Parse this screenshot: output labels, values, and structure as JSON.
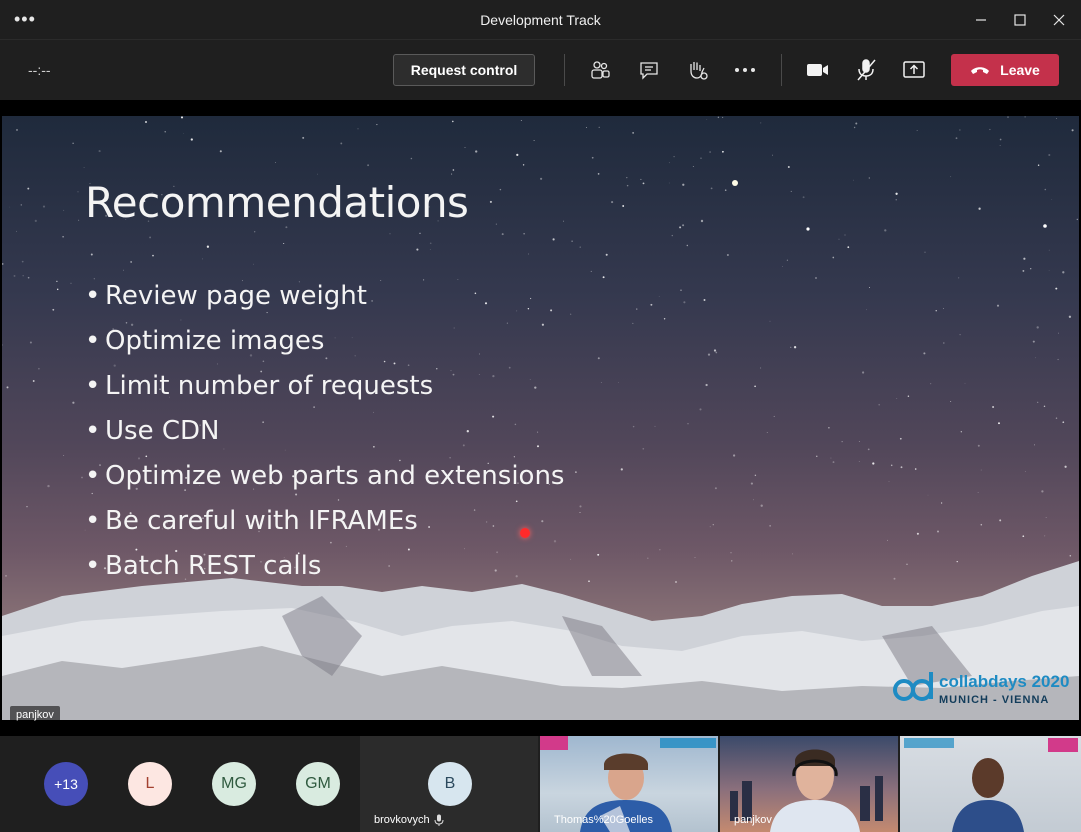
{
  "window": {
    "title": "Development Track"
  },
  "toolbar": {
    "timer": "--:--",
    "request_control": "Request control",
    "leave": "Leave"
  },
  "slide": {
    "title": "Recommendations",
    "bullets": [
      "Review page weight",
      "Optimize images",
      "Limit number of requests",
      "Use CDN",
      "Optimize web parts and extensions",
      "Be careful with IFRAMEs",
      "Batch REST calls"
    ],
    "logo_brand": "collabdays 2020",
    "logo_sub": "MUNICH - VIENNA",
    "presenter": "panjkov"
  },
  "participants": {
    "overflow": "+13",
    "avatars": [
      {
        "initials": "L",
        "color": "#fde7e2",
        "text_color": "#a34130"
      },
      {
        "initials": "MG",
        "color": "#d9ebe0",
        "text_color": "#2f5a3f"
      },
      {
        "initials": "GM",
        "color": "#d9ebe0",
        "text_color": "#2f5a3f"
      }
    ],
    "tiles": [
      {
        "name": "brovkovych",
        "initials": "B"
      },
      {
        "name": "Thomas%20Goelles"
      },
      {
        "name": "panjkov"
      },
      {
        "name": ""
      }
    ]
  },
  "colors": {
    "leave": "#c4314b",
    "overflow_avatar": "#464eb8"
  }
}
